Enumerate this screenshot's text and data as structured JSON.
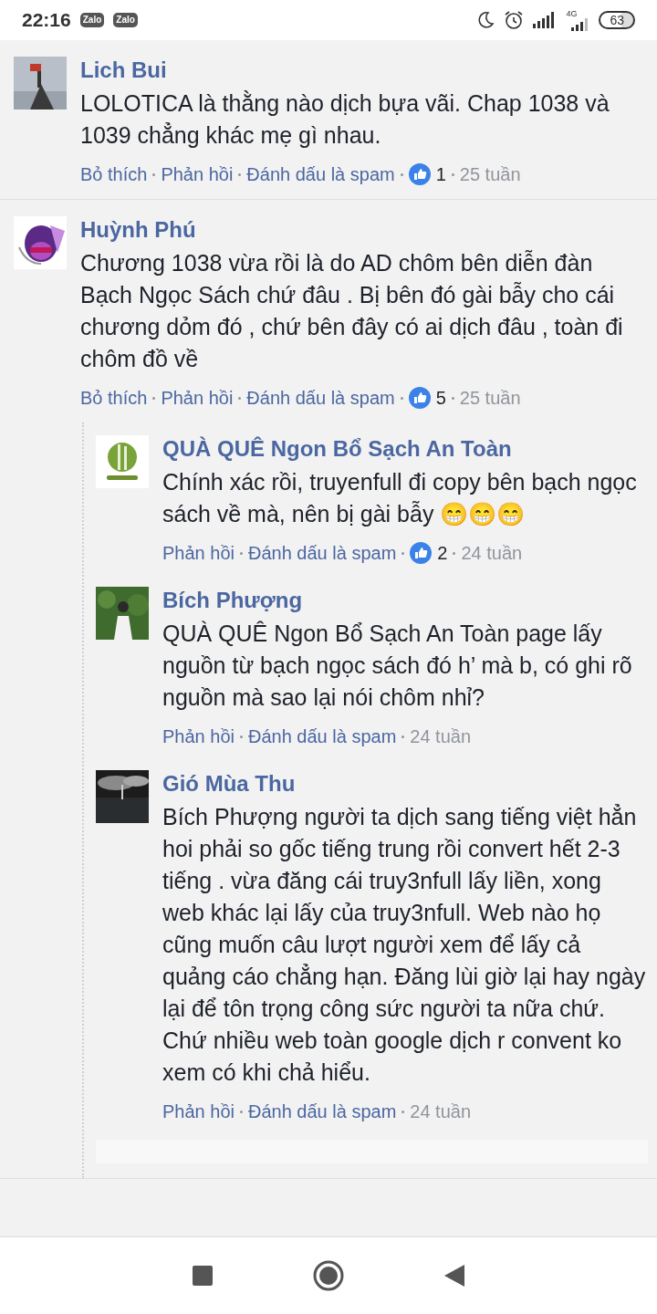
{
  "status_bar": {
    "time": "22:16",
    "app_badges": [
      "Zalo",
      "Zalo"
    ],
    "network": "4G",
    "battery": "63"
  },
  "comments": [
    {
      "name": "Lich Bui",
      "text": "LOLOTICA là thằng nào dịch bựa vãi. Chap 1038 và 1039 chẳng khác mẹ gì nhau.",
      "actions": [
        "Bỏ thích",
        "Phản hồi",
        "Đánh dấu là spam"
      ],
      "likes": "1",
      "time": "25 tuần"
    },
    {
      "name": "Huỳnh Phú",
      "text": "Chương 1038 vừa rồi là do AD chôm bên diễn đàn Bạch Ngọc Sách chứ đâu . Bị bên đó gài bẫy cho cái chương dỏm đó , chứ bên đây có ai dịch đâu , toàn đi chôm đồ về",
      "actions": [
        "Bỏ thích",
        "Phản hồi",
        "Đánh dấu là spam"
      ],
      "likes": "5",
      "time": "25 tuần",
      "replies": [
        {
          "name": "QUÀ QUÊ Ngon Bổ Sạch An Toàn",
          "text": "Chính xác rồi, truyenfull đi copy bên bạch ngọc sách về mà, nên bị gài bẫy 😁😁😁",
          "actions": [
            "Phản hồi",
            "Đánh dấu là spam"
          ],
          "likes": "2",
          "time": "24 tuần"
        },
        {
          "name": "Bích Phượng",
          "text": "QUÀ QUÊ Ngon Bổ Sạch An Toàn page lấy nguồn từ bạch ngọc sách đó h’ mà b, có ghi rõ nguồn mà sao lại nói chôm nhỉ?",
          "actions": [
            "Phản hồi",
            "Đánh dấu là spam"
          ],
          "time": "24 tuần"
        },
        {
          "name": "Gió Mùa Thu",
          "text": "Bích Phượng người ta dịch sang tiếng việt hẳn hoi phải so gốc tiếng trung rồi convert hết 2-3 tiếng . vừa đăng cái truy3nfull lấy liền, xong web khác lại lấy của truy3nfull. Web nào họ cũng muốn câu lượt người xem để lấy cả quảng cáo chẳng hạn. Đăng lùi giờ lại hay ngày lại để tôn trọng công sức người ta nữa chứ. Chứ nhiều web toàn google dịch r convent ko xem có khi chả hiểu.",
          "actions": [
            "Phản hồi",
            "Đánh dấu là spam"
          ],
          "time": "24 tuần"
        }
      ]
    }
  ]
}
